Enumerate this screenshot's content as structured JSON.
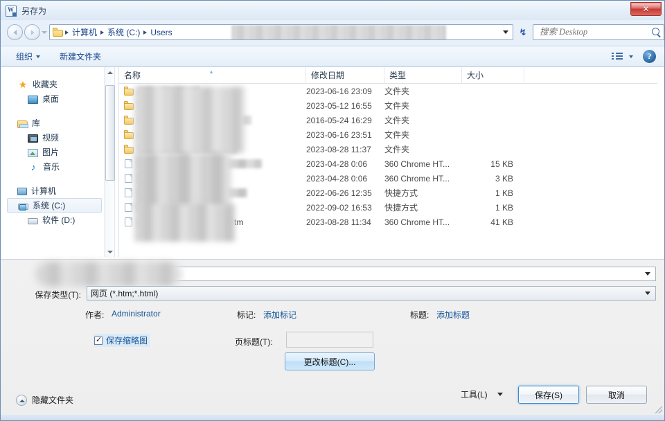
{
  "window": {
    "title": "另存为",
    "app_icon": "word-document-icon",
    "close_label": "✕"
  },
  "nav": {
    "back_tooltip": "后退",
    "forward_tooltip": "前进",
    "breadcrumbs": [
      {
        "label": "计算机"
      },
      {
        "label": "系统 (C:)"
      },
      {
        "label": "Users"
      }
    ],
    "breadcrumb_redacted": true,
    "refresh_glyph": "↯",
    "search_placeholder": "搜索 Desktop"
  },
  "toolbar": {
    "organize_label": "组织",
    "new_folder_label": "新建文件夹",
    "help_glyph": "?"
  },
  "sidebar": {
    "groups": [
      {
        "header": {
          "label": "收藏夹",
          "icon": "star-icon"
        },
        "items": [
          {
            "label": "桌面",
            "icon": "desktop-icon",
            "selected": false
          }
        ]
      },
      {
        "header": {
          "label": "库",
          "icon": "library-icon"
        },
        "items": [
          {
            "label": "视频",
            "icon": "video-icon",
            "selected": false
          },
          {
            "label": "图片",
            "icon": "picture-icon",
            "selected": false
          },
          {
            "label": "音乐",
            "icon": "music-icon",
            "selected": false
          }
        ]
      },
      {
        "header": {
          "label": "计算机",
          "icon": "computer-icon"
        },
        "items": [
          {
            "label": "系统 (C:)",
            "icon": "system-drive-icon",
            "selected": true
          },
          {
            "label": "软件 (D:)",
            "icon": "drive-icon",
            "selected": false
          }
        ]
      }
    ]
  },
  "filelist": {
    "columns": [
      {
        "key": "name",
        "label": "名称"
      },
      {
        "key": "date",
        "label": "修改日期"
      },
      {
        "key": "type",
        "label": "类型"
      },
      {
        "key": "size",
        "label": "大小"
      }
    ],
    "sort_column": "名称",
    "sort_direction": "asc",
    "rows": [
      {
        "name": "",
        "name_redacted": true,
        "icon": "folder-icon",
        "date": "2023-06-16 23:09",
        "type": "文件夹",
        "size": ""
      },
      {
        "name": "",
        "name_redacted": true,
        "icon": "folder-icon",
        "date": "2023-05-12 16:55",
        "type": "文件夹",
        "size": ""
      },
      {
        "name": "",
        "name_redacted": true,
        "icon": "folder-icon",
        "date": "2016-05-24 16:29",
        "type": "文件夹",
        "size": ""
      },
      {
        "name": "",
        "name_redacted": true,
        "icon": "folder-icon",
        "date": "2023-06-16 23:51",
        "type": "文件夹",
        "size": ""
      },
      {
        "name": "",
        "name_redacted": true,
        "icon": "folder-icon",
        "date": "2023-08-28 11:37",
        "type": "文件夹",
        "size": ""
      },
      {
        "name": "",
        "name_redacted": true,
        "icon": "document-icon",
        "date": "2023-04-28 0:06",
        "type": "360 Chrome HT...",
        "size": "15 KB"
      },
      {
        "name": "",
        "name_redacted": true,
        "icon": "document-icon",
        "date": "2023-04-28 0:06",
        "type": "360 Chrome HT...",
        "size": "3 KB"
      },
      {
        "name": "",
        "name_redacted": true,
        "icon": "shortcut-icon",
        "date": "2022-06-26 12:35",
        "type": "快捷方式",
        "size": "1 KB"
      },
      {
        "name": "",
        "name_redacted": true,
        "icon": "shortcut-icon",
        "date": "2022-09-02 16:53",
        "type": "快捷方式",
        "size": "1 KB"
      },
      {
        "name": "tm",
        "name_redacted": true,
        "icon": "document-icon",
        "date": "2023-08-28 11:34",
        "type": "360 Chrome HT...",
        "size": "41 KB"
      }
    ]
  },
  "form": {
    "filename_label": "文件名",
    "filename_value": "tm",
    "filename_redacted": true,
    "savetype_label": "保存类型(T):",
    "savetype_value": "网页 (*.htm;*.html)",
    "meta": {
      "author_label": "作者:",
      "author_value": "Administrator",
      "tags_label": "标记:",
      "tags_value": "添加标记",
      "title_label": "标题:",
      "title_value": "添加标题"
    },
    "save_thumbnail_label": "保存缩略图",
    "save_thumbnail_checked": true,
    "page_title_label": "页标题(T):",
    "page_title_value": "",
    "change_title_label": "更改标题(C)..."
  },
  "footer": {
    "hide_folders_label": "隐藏文件夹",
    "tools_label": "工具(L)",
    "save_label": "保存(S)",
    "cancel_label": "取消"
  },
  "colors": {
    "link_blue": "#15559a",
    "crumb_blue": "#15428b",
    "close_red": "#c23b35",
    "default_button_glow": "#3c8bc9"
  }
}
